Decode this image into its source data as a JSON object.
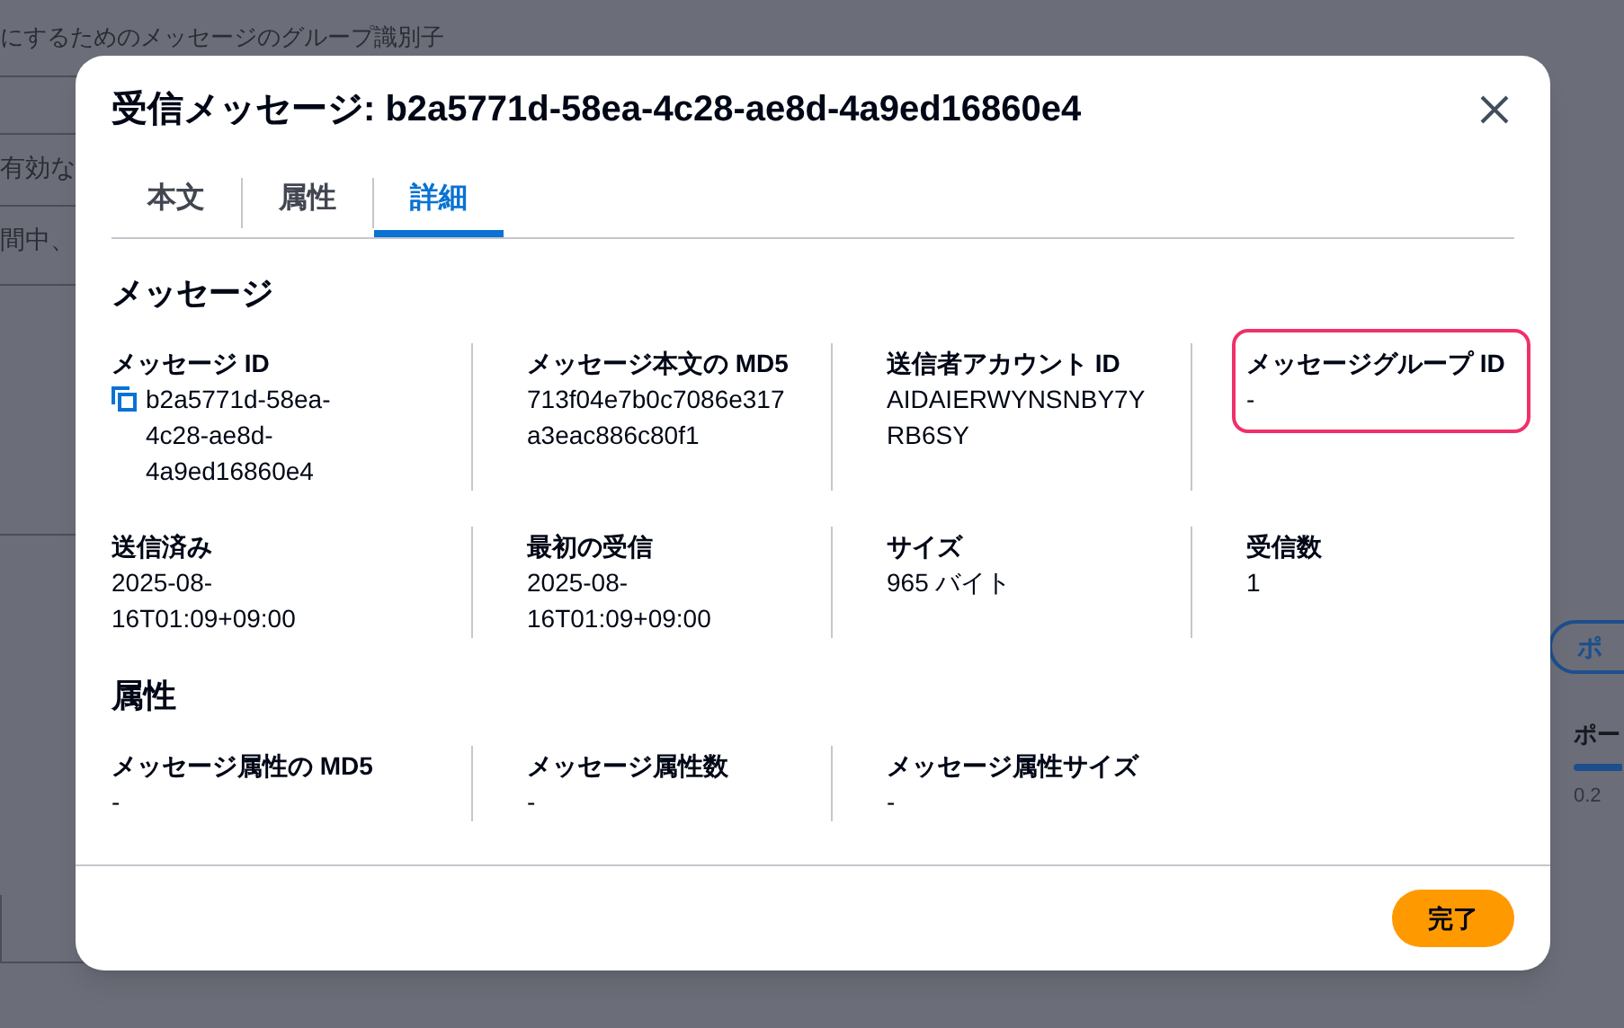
{
  "background": {
    "left_texts": [
      "にするためのメッセージのグループ識別子",
      "有効な",
      "間中、"
    ],
    "right_button": "ポ",
    "right_heading": "ポー",
    "right_caption": "0.2"
  },
  "dialog": {
    "title": "受信メッセージ: b2a5771d-58ea-4c28-ae8d-4a9ed16860e4",
    "tabs": [
      {
        "label": "本文",
        "selected": false
      },
      {
        "label": "属性",
        "selected": false
      },
      {
        "label": "詳細",
        "selected": true
      }
    ],
    "sections": [
      {
        "heading": "メッセージ",
        "fields": [
          {
            "label": "メッセージ ID",
            "value": "b2a5771d-58ea-4c28-ae8d-4a9ed16860e4",
            "copyable": true,
            "highlighted": false
          },
          {
            "label": "メッセージ本文の MD5",
            "value": "713f04e7b0c7086e317a3eac886c80f1",
            "copyable": false,
            "highlighted": false
          },
          {
            "label": "送信者アカウント ID",
            "value": "AIDAIERWYNSNBY7YRB6SY",
            "copyable": false,
            "highlighted": false
          },
          {
            "label": "メッセージグループ ID",
            "value": "-",
            "copyable": false,
            "highlighted": true
          },
          {
            "label": "送信済み",
            "value": "2025-08-16T01:09+09:00",
            "copyable": false,
            "highlighted": false
          },
          {
            "label": "最初の受信",
            "value": "2025-08-16T01:09+09:00",
            "copyable": false,
            "highlighted": false
          },
          {
            "label": "サイズ",
            "value": "965 バイト",
            "copyable": false,
            "highlighted": false
          },
          {
            "label": "受信数",
            "value": "1",
            "copyable": false,
            "highlighted": false
          }
        ]
      },
      {
        "heading": "属性",
        "fields": [
          {
            "label": "メッセージ属性の MD5",
            "value": "-",
            "copyable": false,
            "highlighted": false
          },
          {
            "label": "メッセージ属性数",
            "value": "-",
            "copyable": false,
            "highlighted": false
          },
          {
            "label": "メッセージ属性サイズ",
            "value": "-",
            "copyable": false,
            "highlighted": false
          }
        ]
      }
    ],
    "done_button": "完了"
  }
}
